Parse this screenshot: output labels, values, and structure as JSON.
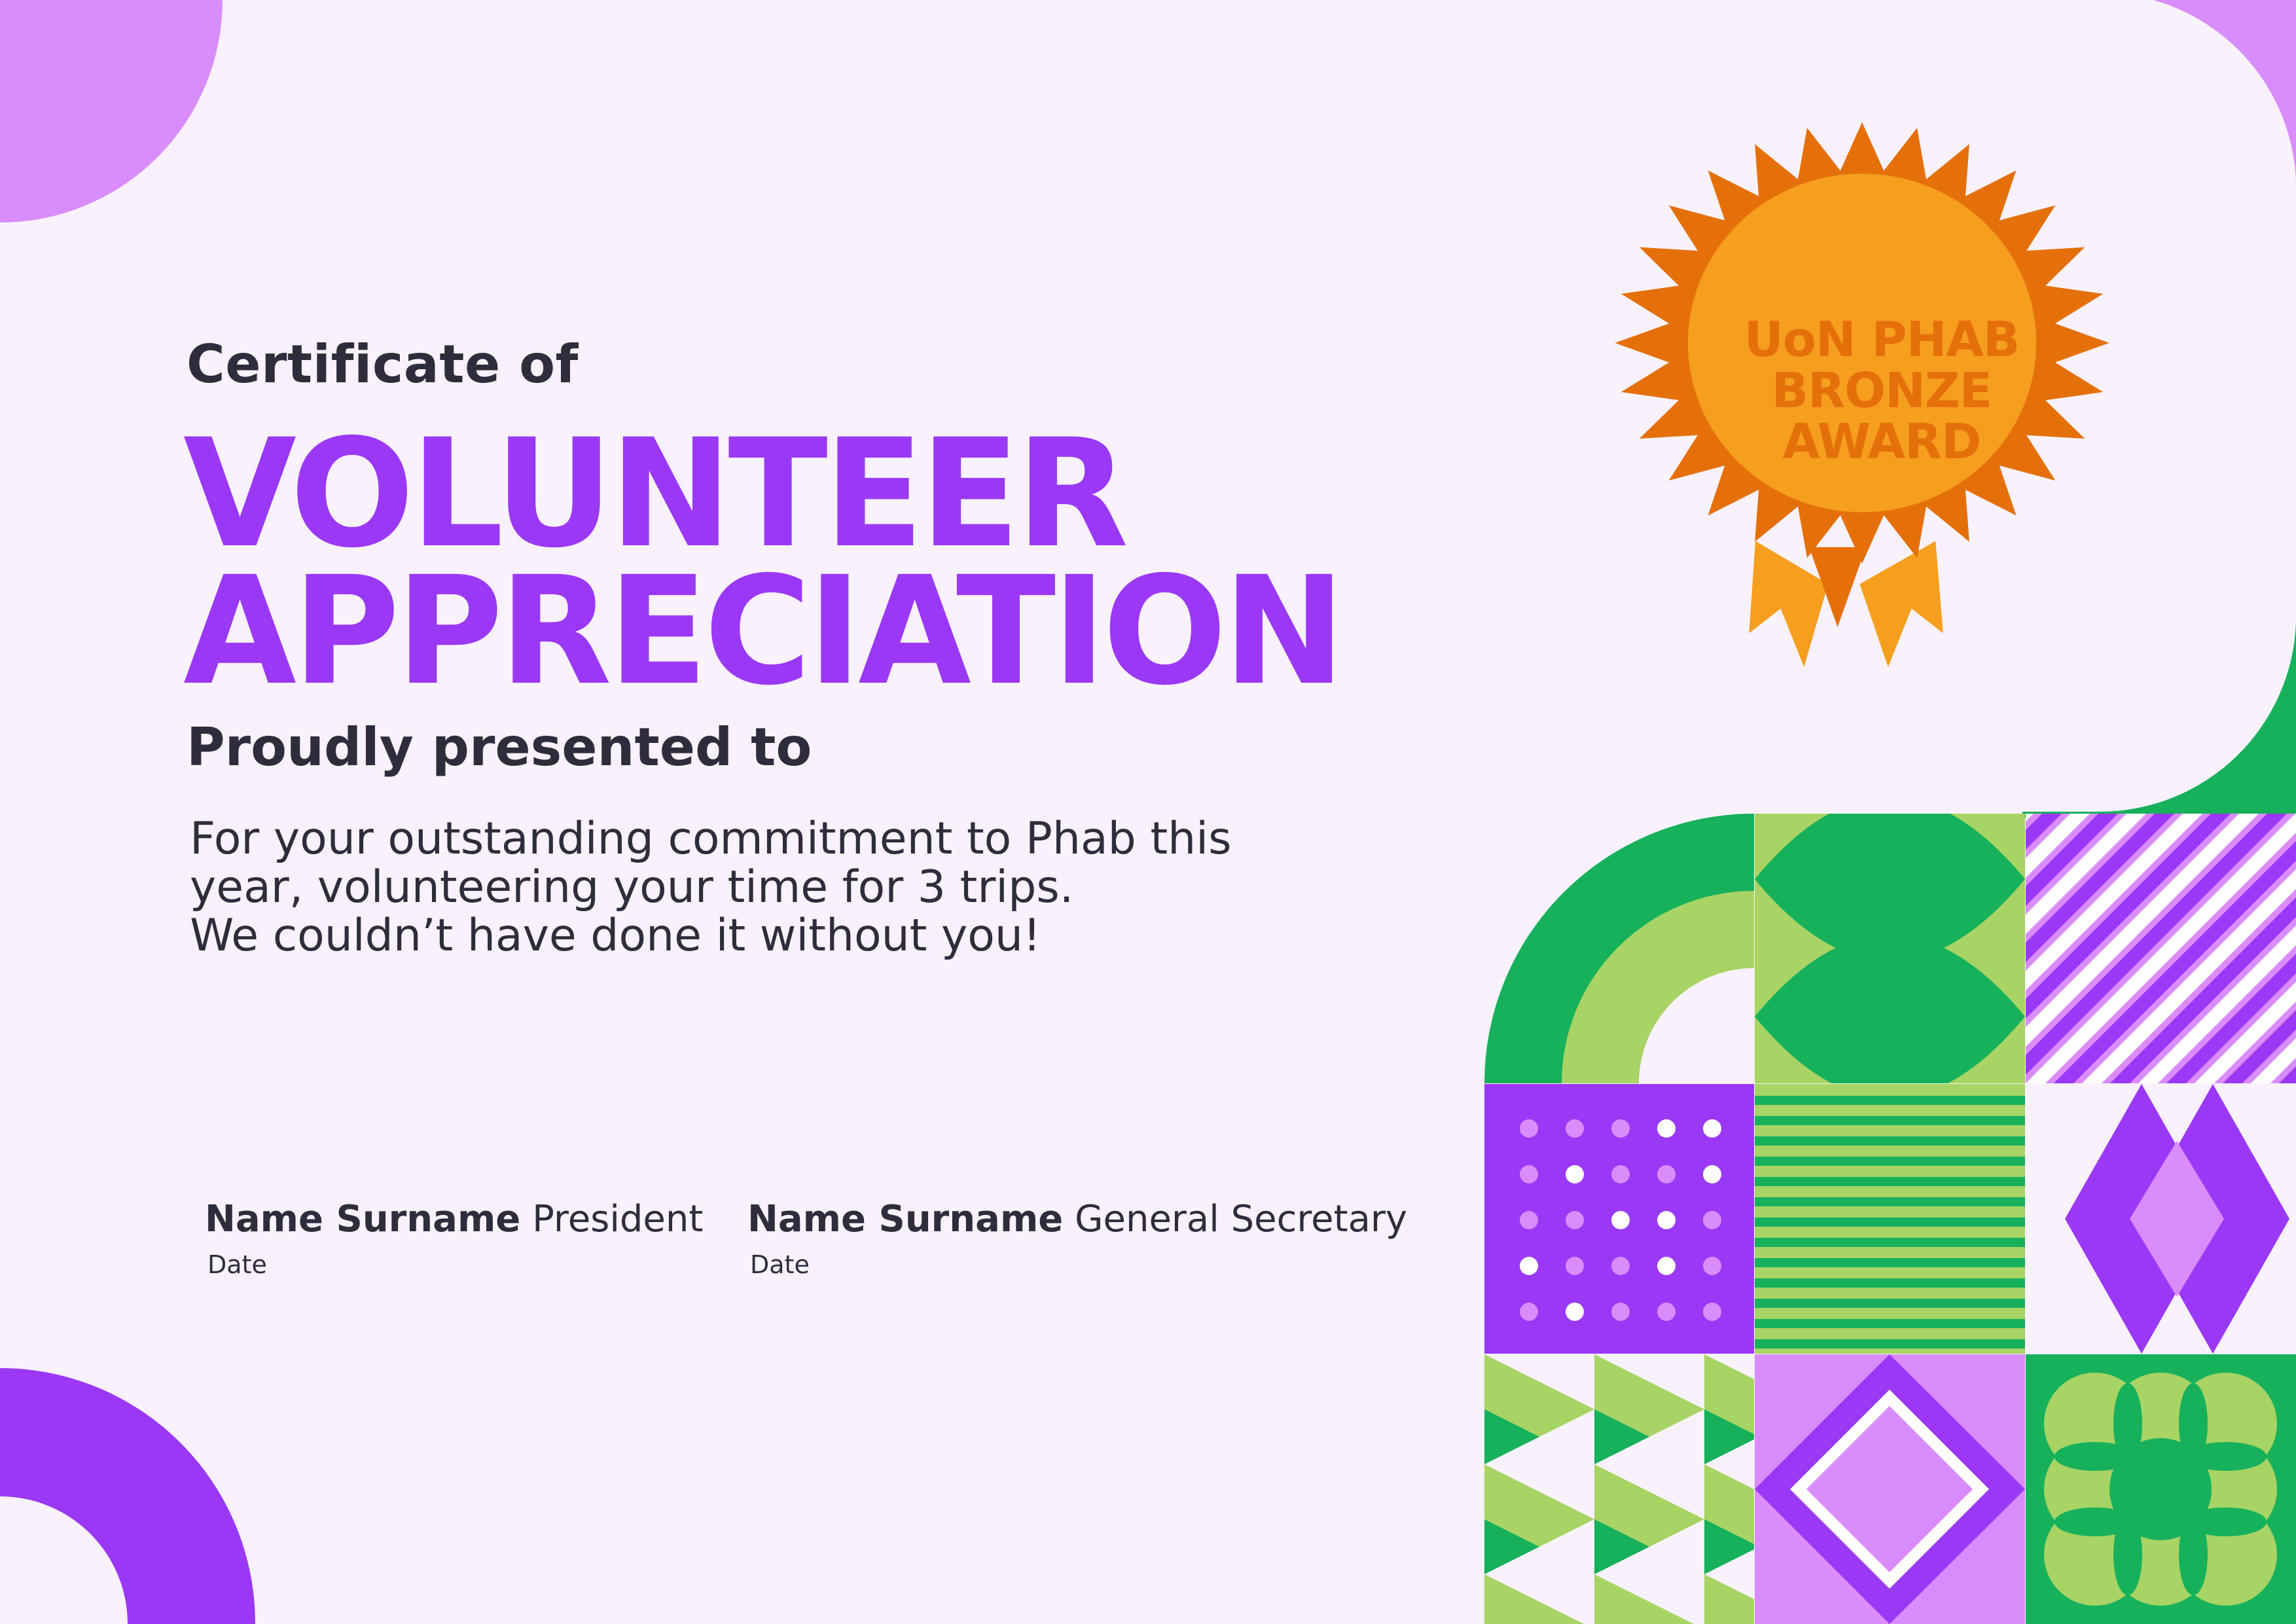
{
  "certificate": {
    "heading": "Certificate of",
    "title_line1": "VOLUNTEER",
    "title_line2": "APPRECIATION",
    "presented_to": "Proudly presented to",
    "message_lines": [
      "For your outstanding commitment to Phab this",
      "year, volunteering your time for 3 trips.",
      "We couldn’t have done it without you!"
    ]
  },
  "badge": {
    "line1": "UoN PHAB",
    "line2": "BRONZE",
    "line3": "AWARD"
  },
  "signatures": [
    {
      "name": "Name Surname",
      "role": "President",
      "date_label": "Date"
    },
    {
      "name": "Name Surname",
      "role": "General Secretary",
      "date_label": "Date"
    }
  ],
  "colors": {
    "background": "#f9f2fd",
    "purple": "#9b38f5",
    "lilac": "#d98cfc",
    "green": "#17b15c",
    "lime": "#a7d464",
    "orange": "#e5700a",
    "orange_light": "#f69e1e",
    "text": "#2e2d3c"
  }
}
